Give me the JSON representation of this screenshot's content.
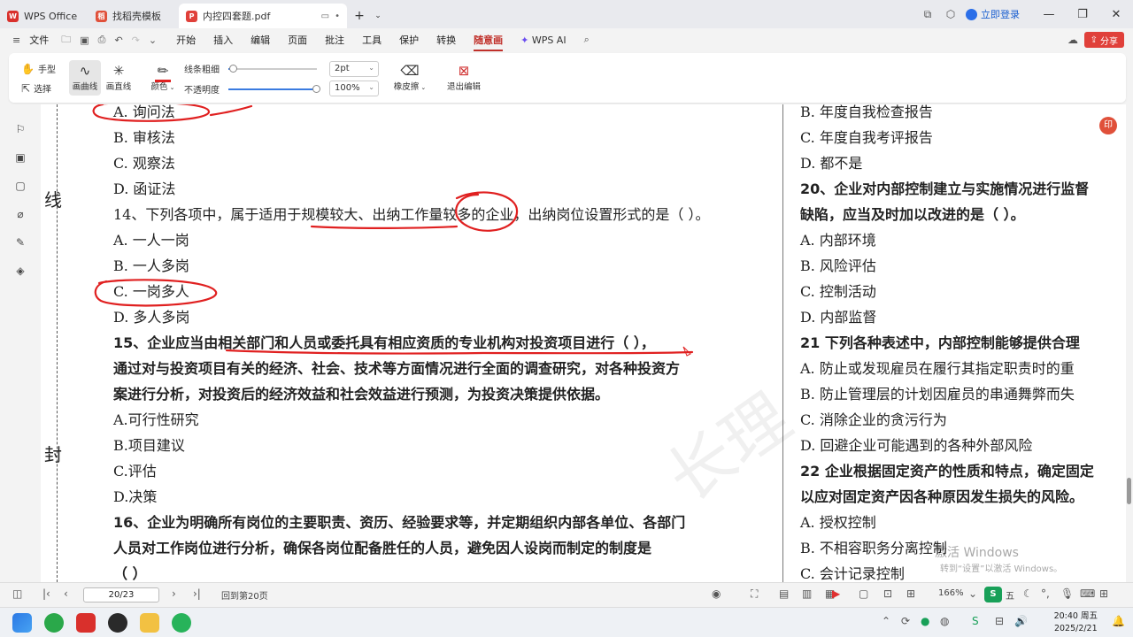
{
  "window": {
    "tabs": [
      {
        "label": "WPS Office"
      },
      {
        "label": "找稻壳模板"
      },
      {
        "label": "内控四套题.pdf"
      }
    ],
    "login_label": "立即登录"
  },
  "menu": {
    "file_label": "文件",
    "items": [
      "开始",
      "插入",
      "编辑",
      "页面",
      "批注",
      "工具",
      "保护",
      "转换",
      "随意画",
      "WPS AI"
    ],
    "share_label": "分享"
  },
  "ribbon": {
    "hand_label": "手型",
    "select_label": "选择",
    "curve_label": "画曲线",
    "line_label": "画直线",
    "color_label": "颜色",
    "line_width_label": "线条粗细",
    "opacity_label": "不透明度",
    "line_width_value": "2pt",
    "opacity_value": "100%",
    "eraser_label": "橡皮擦",
    "exit_label": "退出编辑",
    "line_width_fraction": 0.05,
    "opacity_fraction": 1.0,
    "pen_color": "#e02020"
  },
  "document": {
    "bind_chars": [
      "线",
      "封"
    ],
    "left_lines": [
      "A. 询问法",
      "B. 审核法",
      "C. 观察法",
      "D. 函证法",
      "14、下列各项中，属于适用于规模较大、出纳工作量较多的企业，出纳岗位设置形式的是（    ）。",
      "A. 一人一岗",
      "B. 一人多岗",
      "C. 一岗多人",
      "D. 多人多岗",
      "15、企业应当由相关部门和人员或委托具有相应资质的专业机构对投资项目进行（       ），",
      "通过对与投资项目有关的经济、社会、技术等方面情况进行全面的调查研究，对各种投资方",
      "案进行分析，对投资后的经济效益和社会效益进行预测，为投资决策提供依据。",
      "A.可行性研究",
      "B.项目建议",
      "C.评估",
      "D.决策",
      "16、企业为明确所有岗位的主要职责、资历、经验要求等，并定期组织内部各单位、各部门",
      "人员对工作岗位进行分析，确保各岗位配备胜任的人员，避免因人设岗而制定的制度是",
      "（     ）"
    ],
    "right_lines": [
      "B. 年度自我检查报告",
      "C. 年度自我考评报告",
      "D. 都不是",
      "20、企业对内部控制建立与实施情况进行监督",
      "缺陷，应当及时加以改进的是（        ）。",
      "A. 内部环境",
      "B. 风险评估",
      "C. 控制活动",
      "D. 内部监督",
      "21 下列各种表述中，内部控制能够提供合理",
      "A. 防止或发现雇员在履行其指定职责时的重",
      "B. 防止管理层的计划因雇员的串通舞弊而失",
      "C. 消除企业的贪污行为",
      "D. 回避企业可能遇到的各种外部风险",
      "22 企业根据固定资产的性质和特点，确定固定",
      "以应对固定资产因各种原因发生损失的风险。",
      "A. 授权控制",
      "B. 不相容职务分离控制",
      "C. 会计记录控制"
    ],
    "watermark": "长理",
    "badge": "印",
    "activation_title": "激活 Windows",
    "activation_sub": "转到“设置”以激活 Windows。"
  },
  "statusbar": {
    "page_value": "20/23",
    "back_label": "回到第20页",
    "zoom": "166%",
    "ime_label": "五"
  },
  "taskbar": {
    "time": "20:40 周五",
    "date": "2025/2/21"
  }
}
